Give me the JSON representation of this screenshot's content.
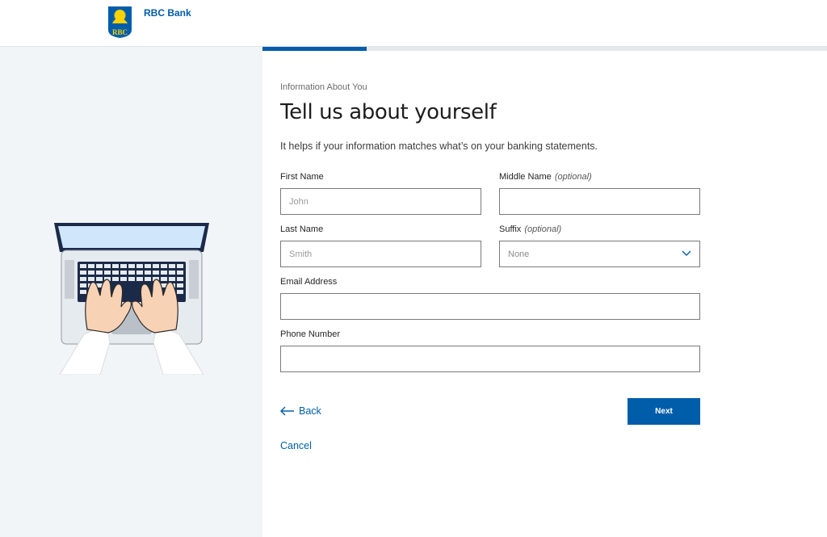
{
  "header": {
    "brand_name": "RBC Bank",
    "logo_text": "RBC"
  },
  "progress": {
    "fraction": 0.185
  },
  "form": {
    "eyebrow": "Information About You",
    "title": "Tell us about yourself",
    "subtitle": "It helps if your information matches what’s on your banking statements.",
    "fields": {
      "first_name": {
        "label": "First Name",
        "placeholder": "John",
        "value": ""
      },
      "middle_name": {
        "label": "Middle Name",
        "optional": "(optional)",
        "value": ""
      },
      "last_name": {
        "label": "Last Name",
        "placeholder": "Smith",
        "value": ""
      },
      "suffix": {
        "label": "Suffix",
        "optional": "(optional)",
        "selected": "None"
      },
      "email": {
        "label": "Email Address",
        "value": ""
      },
      "phone": {
        "label": "Phone Number",
        "value": ""
      }
    },
    "back_label": "Back",
    "next_label": "Next",
    "cancel_label": "Cancel"
  },
  "icons": {
    "logo": "rbc-shield-logo",
    "back": "arrow-left-icon",
    "suffix_dropdown": "chevron-down-icon",
    "illustration": "laptop-typing-illustration"
  },
  "colors": {
    "brand_blue": "#005daa",
    "brand_yellow": "#ffd200",
    "left_panel": "#f2f5f7"
  }
}
